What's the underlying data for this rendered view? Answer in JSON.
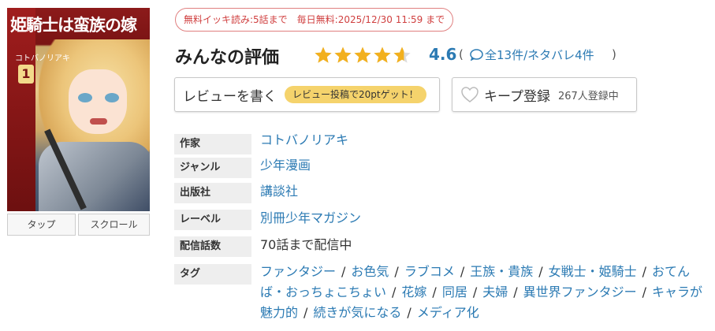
{
  "cover": {
    "title": "姫騎士は蛮族の嫁",
    "author_on_cover": "コトバノリアキ",
    "volume": "1",
    "buttons": [
      "タップ",
      "スクロール"
    ]
  },
  "free_badge": "無料イッキ読み:5話まで　毎日無料:2025/12/30 11:59 まで",
  "rating": {
    "title": "みんなの評価",
    "score": "4.6",
    "stars_value": 4.6,
    "stars_max": 5,
    "open_paren": "(",
    "counts": "全13件/ネタバレ4件",
    "close_paren": ")"
  },
  "review_button": {
    "label": "レビューを書く",
    "bonus": "レビュー投稿で20ptゲット！"
  },
  "keep_button": {
    "label": "キープ登録",
    "count": "267人登録中"
  },
  "info": {
    "author_label": "作家",
    "author_value": "コトバノリアキ",
    "genre_label": "ジャンル",
    "genre_value": "少年漫画",
    "publisher_label": "出版社",
    "publisher_value": "講談社",
    "label_label": "レーベル",
    "label_value": "別冊少年マガジン",
    "episodes_label": "配信話数",
    "episodes_value": "70話まで配信中",
    "tags_label": "タグ",
    "tags": [
      "ファンタジー",
      "お色気",
      "ラブコメ",
      "王族・貴族",
      "女戦士・姫騎士",
      "おてんば・おっちょこちょい",
      "花嫁",
      "同居",
      "夫婦",
      "異世界ファンタジー",
      "キャラが魅力的",
      "続きが気になる",
      "メディア化"
    ]
  },
  "colors": {
    "link": "#2b7ab3",
    "star": "#f2b01e",
    "badge_border": "#e08080",
    "bonus_bg": "#f5d36c",
    "label_bg": "#eeeeee"
  }
}
